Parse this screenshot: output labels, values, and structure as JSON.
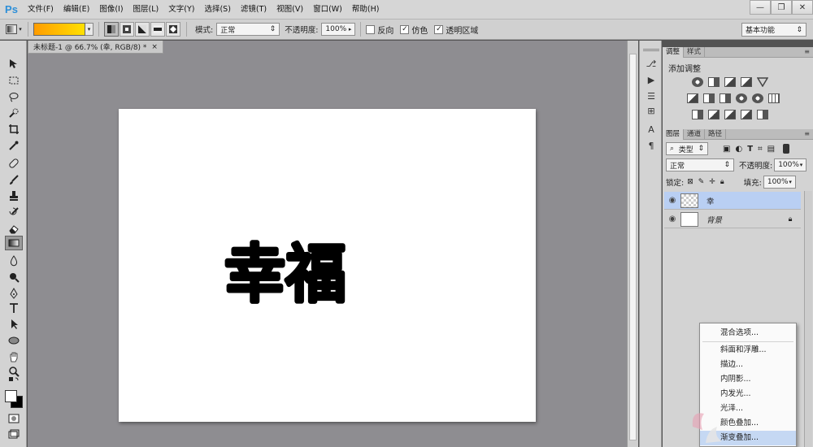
{
  "app": {
    "logo": "Ps"
  },
  "menu": [
    "文件(F)",
    "编辑(E)",
    "图像(I)",
    "图层(L)",
    "文字(Y)",
    "选择(S)",
    "滤镜(T)",
    "视图(V)",
    "窗口(W)",
    "帮助(H)"
  ],
  "window_controls": {
    "minimize": "—",
    "restore": "❐",
    "close": "✕"
  },
  "options": {
    "mode_label": "模式:",
    "mode_value": "正常",
    "opacity_label": "不透明度:",
    "opacity_value": "100%",
    "reverse_label": "反向",
    "dither_label": "仿色",
    "transparency_label": "透明区域",
    "reverse_checked": false,
    "dither_checked": true,
    "transparency_checked": true,
    "gradient_colors": [
      "#ff9c00",
      "#ffe000"
    ]
  },
  "workspace": {
    "value": "基本功能"
  },
  "document": {
    "tab_title": "未标题-1 @ 66.7% (幸, RGB/8) *",
    "close": "×",
    "text": "幸福"
  },
  "panels": {
    "adjust_tabs": [
      "调整",
      "样式"
    ],
    "adjust_title": "添加调整",
    "layers_tabs": [
      "图层",
      "通道",
      "路径"
    ],
    "filter_type": "类型",
    "blend_mode": "正常",
    "opacity_label": "不透明度:",
    "opacity_value": "100%",
    "lock_label": "锁定:",
    "fill_label": "填充:",
    "fill_value": "100%",
    "layers": [
      {
        "name": "幸",
        "selected": true
      },
      {
        "name": "背景",
        "selected": false
      }
    ]
  },
  "context_menu": [
    "混合选项...",
    "斜面和浮雕...",
    "描边...",
    "内阴影...",
    "内发光...",
    "光泽...",
    "颜色叠加...",
    "渐变叠加..."
  ],
  "colors": {
    "accent": "#2d8fd8",
    "selection": "#b9cff3",
    "canvas_bg": "#8e8d91"
  }
}
